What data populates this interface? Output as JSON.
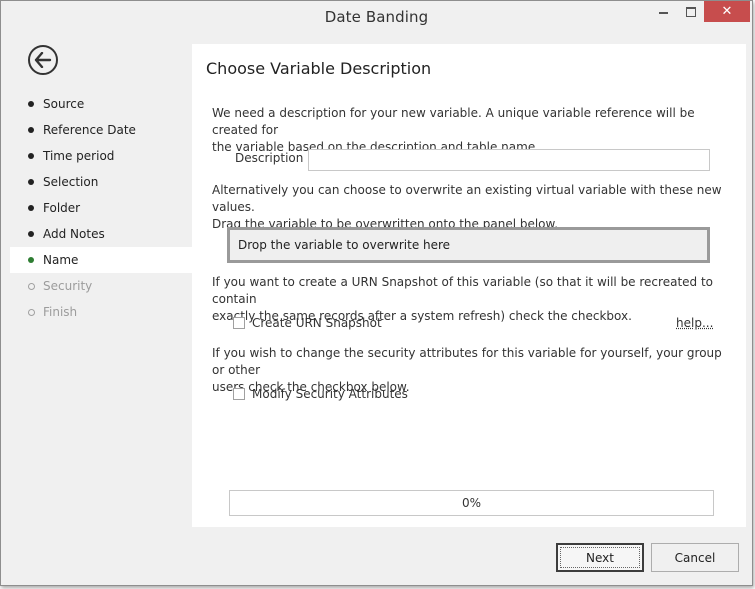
{
  "window": {
    "title": "Date Banding",
    "controls": {
      "minimize": "minimize",
      "maximize": "maximize",
      "close": "✕"
    }
  },
  "sidebar": {
    "back_icon": "back-arrow-icon",
    "items": [
      {
        "label": "Source",
        "state": "completed"
      },
      {
        "label": "Reference Date",
        "state": "completed"
      },
      {
        "label": "Time period",
        "state": "completed"
      },
      {
        "label": "Selection",
        "state": "completed"
      },
      {
        "label": "Folder",
        "state": "completed"
      },
      {
        "label": "Add Notes",
        "state": "completed"
      },
      {
        "label": "Name",
        "state": "active"
      },
      {
        "label": "Security",
        "state": "disabled"
      },
      {
        "label": "Finish",
        "state": "disabled"
      }
    ]
  },
  "panel": {
    "title": "Choose Variable Description",
    "intro_line1": "We need a description for your new variable.  A unique variable reference will be created for",
    "intro_line2": "the variable based on the description and table name.",
    "description_label": "Description",
    "description_value": "",
    "overwrite_line1": "Alternatively you can choose to overwrite an existing virtual variable with these new values.",
    "overwrite_line2": "Drag the variable to be overwritten onto the panel below.",
    "drop_zone_text": "Drop the variable to overwrite here",
    "urn_line1": "If you want to create a URN Snapshot of this variable (so that it will be recreated to contain",
    "urn_line2": "exactly the same records after a system refresh) check the checkbox.",
    "urn_checkbox_label": "Create URN Snapshot",
    "urn_checked": false,
    "help_link": "help...",
    "security_line1": "If you wish to change the security attributes for this variable for yourself, your group or other",
    "security_line2": "users check the checkbox below.",
    "security_checkbox_label": "Modify Security Attributes",
    "security_checked": false,
    "progress_text": "0%",
    "progress_value": 0
  },
  "footer": {
    "next_label": "Next",
    "cancel_label": "Cancel"
  },
  "colors": {
    "active_bullet": "#2e7d32",
    "close_button": "#c74d4d",
    "progress_fill": "#06b025"
  }
}
